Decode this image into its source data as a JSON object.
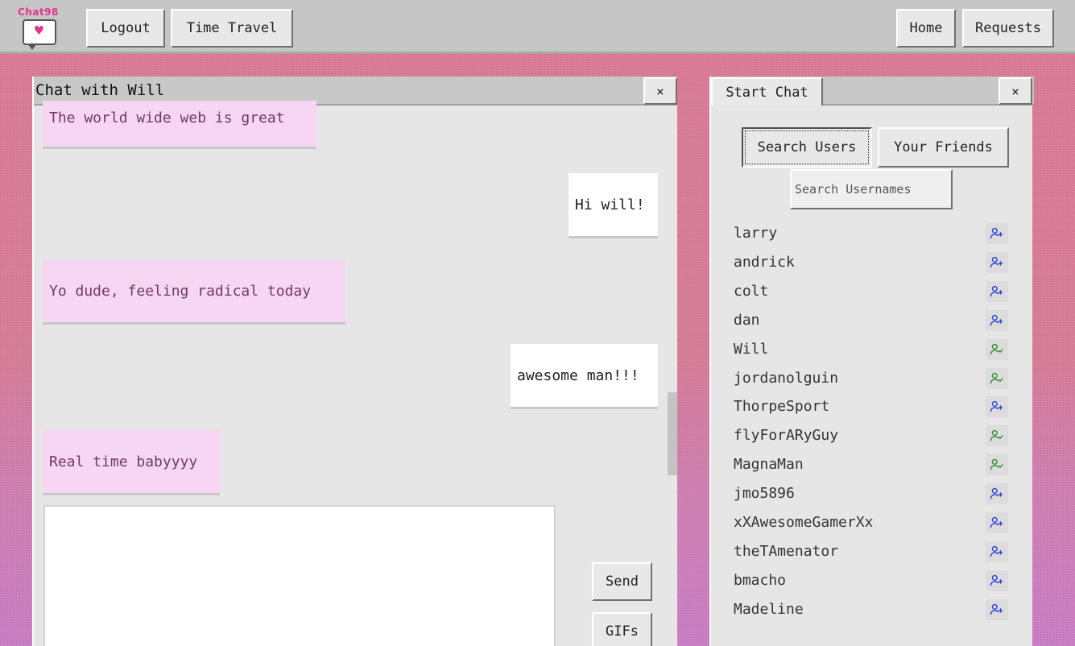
{
  "app": {
    "logo_text": "Chat98"
  },
  "topbar": {
    "logout": "Logout",
    "time_travel": "Time Travel",
    "home": "Home",
    "requests": "Requests"
  },
  "chat": {
    "title": "Chat with Will",
    "close": "×",
    "messages": [
      {
        "from": "them",
        "text": "The world wide web is great"
      },
      {
        "from": "me",
        "text": "Hi will!"
      },
      {
        "from": "them",
        "text": "Yo dude, feeling radical today"
      },
      {
        "from": "me",
        "text": "awesome man!!!"
      },
      {
        "from": "them",
        "text": "Real time babyyyy"
      }
    ],
    "send": "Send",
    "gifs": "GIFs"
  },
  "start_chat": {
    "tab": "Start Chat",
    "close": "×",
    "search_users": "Search Users",
    "your_friends": "Your Friends",
    "search_placeholder": "Search Usernames",
    "users": [
      {
        "name": "larry",
        "status": "add",
        "icon": "user-plus-icon"
      },
      {
        "name": "andrick",
        "status": "add",
        "icon": "user-plus-icon"
      },
      {
        "name": "colt",
        "status": "add",
        "icon": "user-plus-icon"
      },
      {
        "name": "dan",
        "status": "add",
        "icon": "user-plus-icon"
      },
      {
        "name": "Will",
        "status": "friend",
        "icon": "user-check-icon"
      },
      {
        "name": "jordanolguin",
        "status": "friend",
        "icon": "user-check-icon"
      },
      {
        "name": "ThorpeSport",
        "status": "add",
        "icon": "user-plus-icon"
      },
      {
        "name": "flyForARyGuy",
        "status": "friend",
        "icon": "user-check-icon"
      },
      {
        "name": "MagnaMan",
        "status": "friend",
        "icon": "user-check-icon"
      },
      {
        "name": "jmo5896",
        "status": "add",
        "icon": "user-plus-icon"
      },
      {
        "name": "xXAwesomeGamerXx",
        "status": "add",
        "icon": "user-plus-icon"
      },
      {
        "name": "theTAmenator",
        "status": "add",
        "icon": "user-plus-icon"
      },
      {
        "name": "bmacho",
        "status": "add",
        "icon": "user-plus-icon"
      },
      {
        "name": "Madeline",
        "status": "add",
        "icon": "user-plus-icon"
      }
    ]
  },
  "colors": {
    "add_icon": "#2a3fd6",
    "friend_icon": "#2e8b2e",
    "logo": "#e2358f"
  }
}
